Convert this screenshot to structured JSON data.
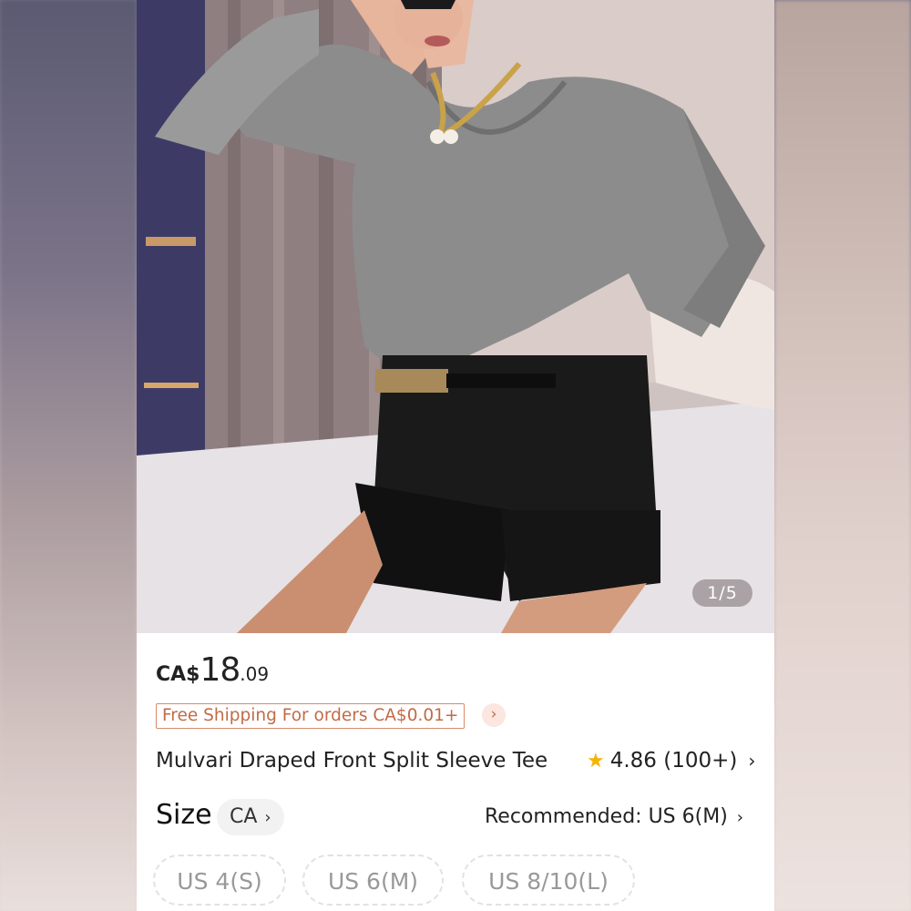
{
  "gallery": {
    "counter": "1/5"
  },
  "product": {
    "price_currency": "CA$",
    "price_integer": "18",
    "price_decimal": ".09",
    "shipping_text": "Free Shipping For orders CA$0.01+",
    "title": "Mulvari Draped Front Split Sleeve Tee"
  },
  "rating": {
    "score": "4.86",
    "count": "(100+)",
    "chevron": "›"
  },
  "size": {
    "label": "Size",
    "region": "CA",
    "recommended": "Recommended: US 6(M)",
    "options": [
      "US 4(S)",
      "US 6(M)",
      "US 8/10(L)"
    ]
  },
  "icons": {
    "star": "star-icon",
    "chevron": "chevron-right-icon"
  },
  "colors": {
    "accent": "#c26b47",
    "star": "#f5b301"
  }
}
